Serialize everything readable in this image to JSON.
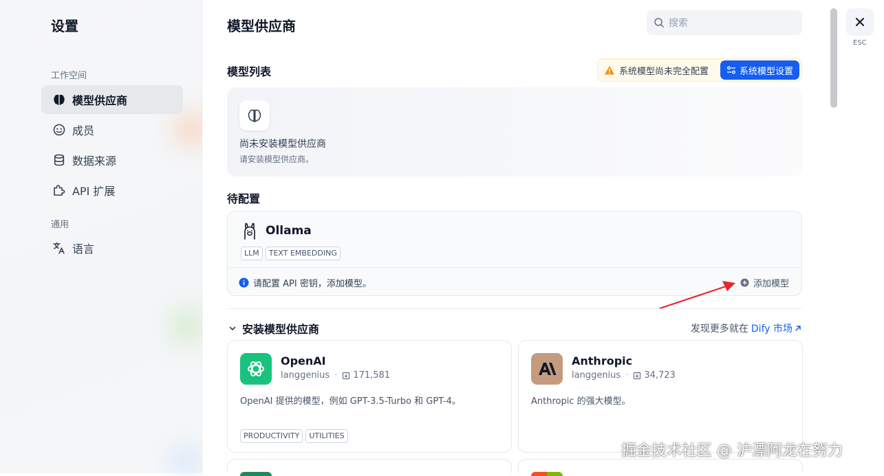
{
  "sidebar": {
    "title": "设置",
    "workspace_group": "工作空间",
    "general_group": "通用",
    "items": [
      {
        "label": "模型供应商",
        "icon": "brain-icon"
      },
      {
        "label": "成员",
        "icon": "members-icon"
      },
      {
        "label": "数据来源",
        "icon": "database-icon"
      },
      {
        "label": "API 扩展",
        "icon": "puzzle-icon"
      },
      {
        "label": "语言",
        "icon": "translate-icon"
      }
    ]
  },
  "main": {
    "title": "模型供应商",
    "search_placeholder": "搜索",
    "model_list": {
      "title": "模型列表",
      "warning": "系统模型尚未完全配置",
      "system_settings_button": "系统模型设置",
      "empty_title": "尚未安装模型供应商",
      "empty_subtitle": "请安装模型供应商。"
    },
    "pending": {
      "title": "待配置",
      "provider": {
        "name": "Ollama",
        "tags": [
          "LLM",
          "TEXT EMBEDDING"
        ],
        "info": "请配置 API 密钥，添加模型。",
        "add_button": "添加模型"
      }
    },
    "install": {
      "title": "安装模型供应商",
      "discover_prefix": "发现更多就在",
      "discover_link": "Dify 市场",
      "cards": [
        {
          "name": "OpenAI",
          "author": "langgenius",
          "downloads": "171,581",
          "desc": "OpenAI 提供的模型，例如 GPT-3.5-Turbo 和 GPT-4。",
          "tags": [
            "PRODUCTIVITY",
            "UTILITIES"
          ],
          "color": "#19c37d"
        },
        {
          "name": "Anthropic",
          "author": "langgenius",
          "downloads": "34,723",
          "desc": "Anthropic 的强大模型。",
          "tags": [],
          "color": "#c49b7e"
        }
      ]
    }
  },
  "close": {
    "esc_label": "ESC"
  },
  "watermark": "掘金技术社区 @ 沪漂阿龙在努力",
  "colors": {
    "accent": "#155eef",
    "warning": "#f79009",
    "info": "#155eef"
  }
}
